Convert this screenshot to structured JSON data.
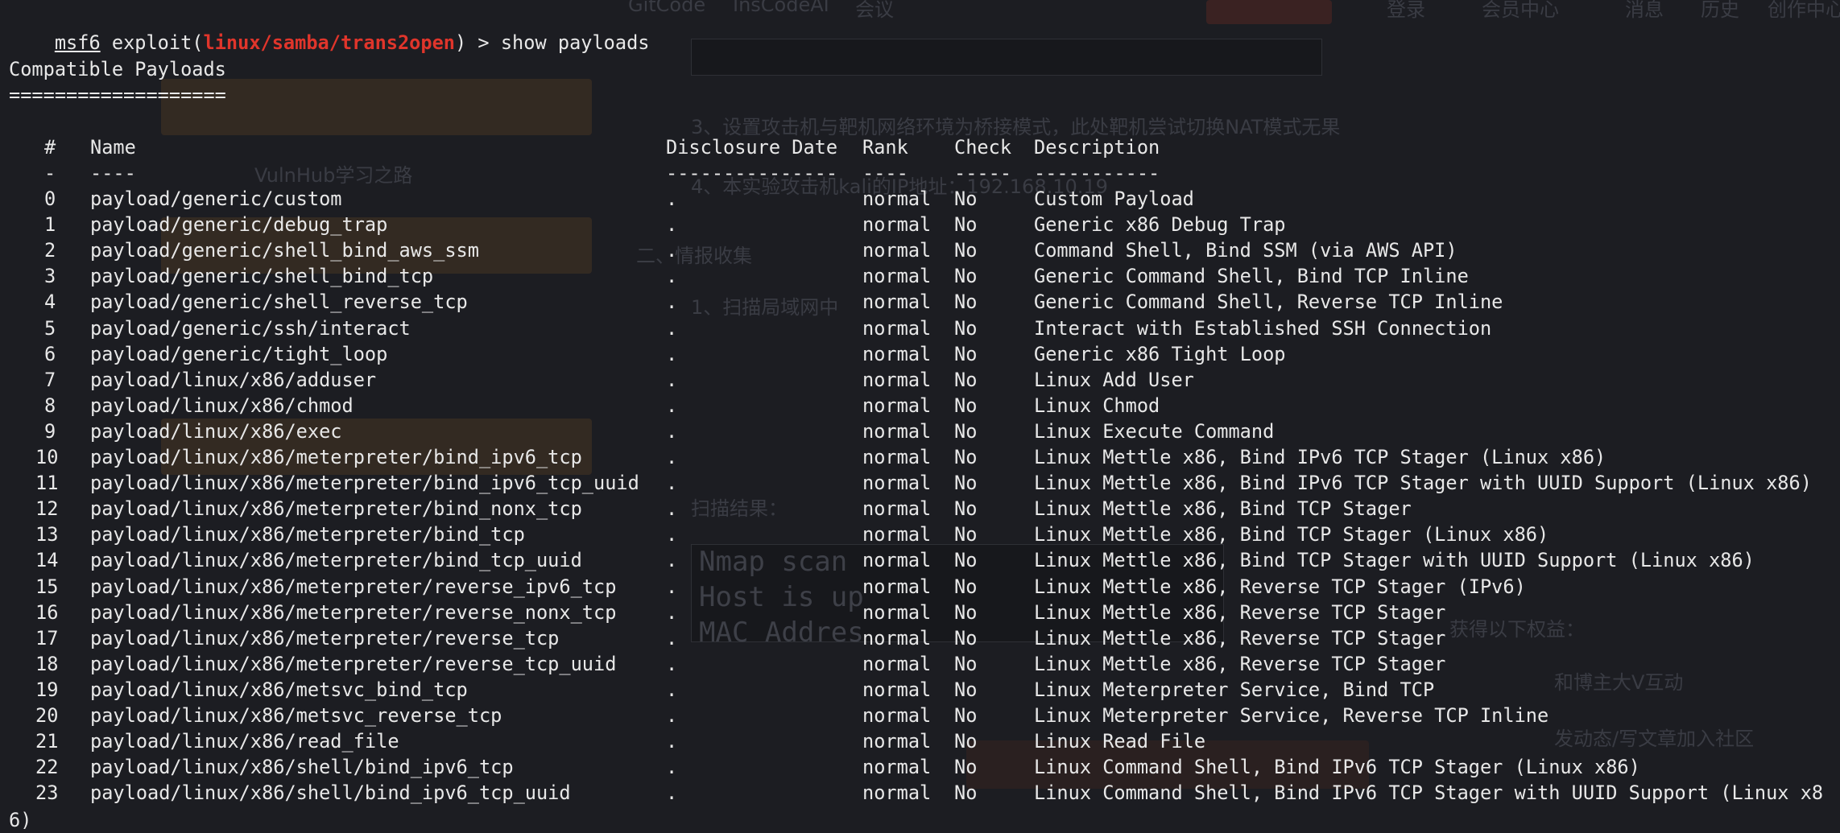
{
  "background": {
    "texts": [
      "GitCode",
      "InsCodeAI",
      "会议",
      "登录",
      "会员中心",
      "消息",
      "历史",
      "创作中心",
      "3、设置攻击机与靶机网络环境为桥接模式，此处靶机尝试切换NAT模式无果",
      "4、本实验攻击机kali的IP地址：192.168.10.19",
      "二、情报收集",
      "1、扫描局域网中",
      "扫描结果：",
      "VulnHub学习之路",
      "和博主大V互动",
      "发动态/写文章加入社区",
      "获得以下权益："
    ],
    "terminal_snippet": [
      "Nmap scan",
      "Host is up",
      "MAC Addres"
    ]
  },
  "terminal": {
    "prompt": {
      "msf": "msf6",
      "exploit_prefix": " exploit(",
      "module": "linux/samba/trans2open",
      "suffix": ") > ",
      "command": "show payloads"
    },
    "section_title": "Compatible Payloads",
    "section_rule": "===================",
    "headers": {
      "num": "#",
      "name": "Name",
      "date": "Disclosure Date",
      "rank": "Rank",
      "check": "Check",
      "desc": "Description"
    },
    "dashes": {
      "num": "-",
      "name": "----",
      "date": "---------------",
      "rank": "----",
      "check": "-----",
      "desc": "-----------"
    },
    "rows": [
      {
        "num": "0",
        "name": "payload/generic/custom",
        "date": ".",
        "rank": "normal",
        "check": "No",
        "desc": "Custom Payload"
      },
      {
        "num": "1",
        "name": "payload/generic/debug_trap",
        "date": ".",
        "rank": "normal",
        "check": "No",
        "desc": "Generic x86 Debug Trap"
      },
      {
        "num": "2",
        "name": "payload/generic/shell_bind_aws_ssm",
        "date": ".",
        "rank": "normal",
        "check": "No",
        "desc": "Command Shell, Bind SSM (via AWS API)"
      },
      {
        "num": "3",
        "name": "payload/generic/shell_bind_tcp",
        "date": ".",
        "rank": "normal",
        "check": "No",
        "desc": "Generic Command Shell, Bind TCP Inline"
      },
      {
        "num": "4",
        "name": "payload/generic/shell_reverse_tcp",
        "date": ".",
        "rank": "normal",
        "check": "No",
        "desc": "Generic Command Shell, Reverse TCP Inline"
      },
      {
        "num": "5",
        "name": "payload/generic/ssh/interact",
        "date": ".",
        "rank": "normal",
        "check": "No",
        "desc": "Interact with Established SSH Connection"
      },
      {
        "num": "6",
        "name": "payload/generic/tight_loop",
        "date": ".",
        "rank": "normal",
        "check": "No",
        "desc": "Generic x86 Tight Loop"
      },
      {
        "num": "7",
        "name": "payload/linux/x86/adduser",
        "date": ".",
        "rank": "normal",
        "check": "No",
        "desc": "Linux Add User"
      },
      {
        "num": "8",
        "name": "payload/linux/x86/chmod",
        "date": ".",
        "rank": "normal",
        "check": "No",
        "desc": "Linux Chmod"
      },
      {
        "num": "9",
        "name": "payload/linux/x86/exec",
        "date": ".",
        "rank": "normal",
        "check": "No",
        "desc": "Linux Execute Command"
      },
      {
        "num": "10",
        "name": "payload/linux/x86/meterpreter/bind_ipv6_tcp",
        "date": ".",
        "rank": "normal",
        "check": "No",
        "desc": "Linux Mettle x86, Bind IPv6 TCP Stager (Linux x86)"
      },
      {
        "num": "11",
        "name": "payload/linux/x86/meterpreter/bind_ipv6_tcp_uuid",
        "date": ".",
        "rank": "normal",
        "check": "No",
        "desc": "Linux Mettle x86, Bind IPv6 TCP Stager with UUID Support (Linux x86)"
      },
      {
        "num": "12",
        "name": "payload/linux/x86/meterpreter/bind_nonx_tcp",
        "date": ".",
        "rank": "normal",
        "check": "No",
        "desc": "Linux Mettle x86, Bind TCP Stager"
      },
      {
        "num": "13",
        "name": "payload/linux/x86/meterpreter/bind_tcp",
        "date": ".",
        "rank": "normal",
        "check": "No",
        "desc": "Linux Mettle x86, Bind TCP Stager (Linux x86)"
      },
      {
        "num": "14",
        "name": "payload/linux/x86/meterpreter/bind_tcp_uuid",
        "date": ".",
        "rank": "normal",
        "check": "No",
        "desc": "Linux Mettle x86, Bind TCP Stager with UUID Support (Linux x86)"
      },
      {
        "num": "15",
        "name": "payload/linux/x86/meterpreter/reverse_ipv6_tcp",
        "date": ".",
        "rank": "normal",
        "check": "No",
        "desc": "Linux Mettle x86, Reverse TCP Stager (IPv6)"
      },
      {
        "num": "16",
        "name": "payload/linux/x86/meterpreter/reverse_nonx_tcp",
        "date": ".",
        "rank": "normal",
        "check": "No",
        "desc": "Linux Mettle x86, Reverse TCP Stager"
      },
      {
        "num": "17",
        "name": "payload/linux/x86/meterpreter/reverse_tcp",
        "date": ".",
        "rank": "normal",
        "check": "No",
        "desc": "Linux Mettle x86, Reverse TCP Stager"
      },
      {
        "num": "18",
        "name": "payload/linux/x86/meterpreter/reverse_tcp_uuid",
        "date": ".",
        "rank": "normal",
        "check": "No",
        "desc": "Linux Mettle x86, Reverse TCP Stager"
      },
      {
        "num": "19",
        "name": "payload/linux/x86/metsvc_bind_tcp",
        "date": ".",
        "rank": "normal",
        "check": "No",
        "desc": "Linux Meterpreter Service, Bind TCP"
      },
      {
        "num": "20",
        "name": "payload/linux/x86/metsvc_reverse_tcp",
        "date": ".",
        "rank": "normal",
        "check": "No",
        "desc": "Linux Meterpreter Service, Reverse TCP Inline"
      },
      {
        "num": "21",
        "name": "payload/linux/x86/read_file",
        "date": ".",
        "rank": "normal",
        "check": "No",
        "desc": "Linux Read File"
      },
      {
        "num": "22",
        "name": "payload/linux/x86/shell/bind_ipv6_tcp",
        "date": ".",
        "rank": "normal",
        "check": "No",
        "desc": "Linux Command Shell, Bind IPv6 TCP Stager (Linux x86)"
      },
      {
        "num": "23",
        "name": "payload/linux/x86/shell/bind_ipv6_tcp_uuid",
        "date": ".",
        "rank": "normal",
        "check": "No",
        "desc": "Linux Command Shell, Bind IPv6 TCP Stager with UUID Support (Linux x8"
      }
    ],
    "wrap_tail": "6)",
    "colors": {
      "background": "#1c1d22",
      "text": "#e8e8e8",
      "module": "#e0352b"
    }
  }
}
